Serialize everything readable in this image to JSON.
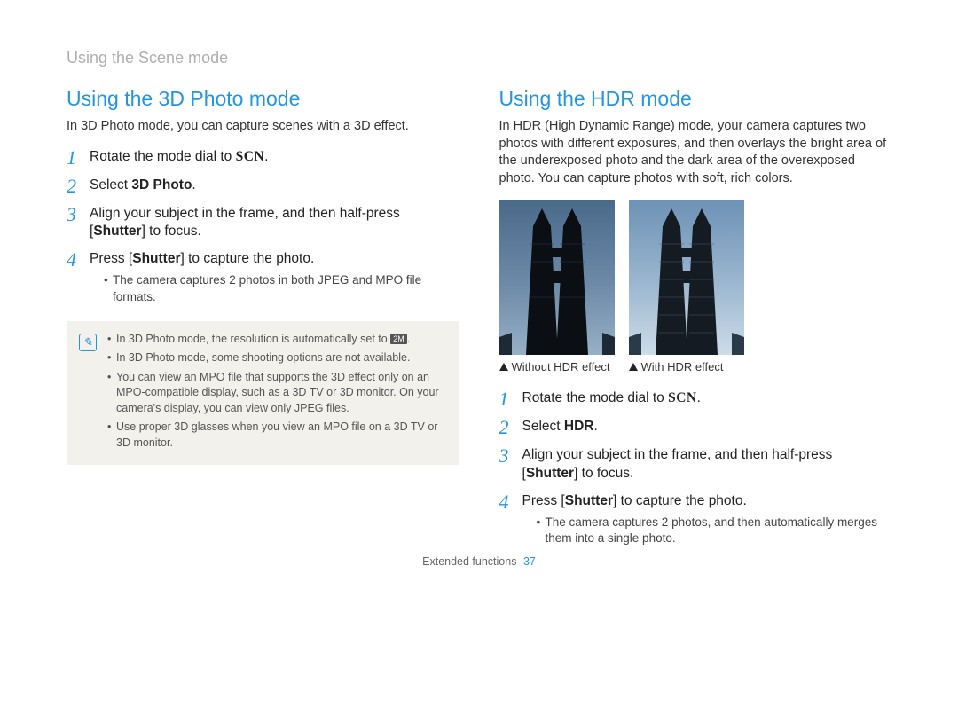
{
  "breadcrumb": "Using the Scene mode",
  "left": {
    "title": "Using the 3D Photo mode",
    "intro": "In 3D Photo mode, you can capture scenes with a 3D effect.",
    "scn_label": "SCN",
    "steps": {
      "s1_pre": "Rotate the mode dial to ",
      "s1_post": ".",
      "s2_pre": "Select ",
      "s2_bold": "3D Photo",
      "s2_post": ".",
      "s3_pre": "Align your subject in the frame, and then half-press [",
      "s3_bold": "Shutter",
      "s3_post": "] to focus.",
      "s4_pre": "Press [",
      "s4_bold": "Shutter",
      "s4_post": "] to capture the photo.",
      "s4_sub1": "The camera captures 2 photos in both JPEG and MPO file formats."
    },
    "notes": {
      "n1_pre": "In 3D Photo mode, the resolution is automatically set to ",
      "n1_chip": "2M",
      "n1_post": ".",
      "n2": "In 3D Photo mode, some shooting options are not available.",
      "n3": "You can view an MPO file that supports the 3D effect only on an MPO-compatible display, such as a 3D TV or 3D monitor. On your camera's display, you can view only JPEG files.",
      "n4": "Use proper 3D glasses when you view an MPO file on a 3D TV or 3D monitor."
    }
  },
  "right": {
    "title": "Using the HDR mode",
    "intro": "In HDR (High Dynamic Range) mode, your camera captures two photos with different exposures, and then overlays the bright area of the underexposed photo and the dark area of the overexposed photo. You can capture photos with soft, rich colors.",
    "caption_without": "Without HDR effect",
    "caption_with": "With HDR effect",
    "scn_label": "SCN",
    "steps": {
      "s1_pre": "Rotate the mode dial to ",
      "s1_post": ".",
      "s2_pre": "Select ",
      "s2_bold": "HDR",
      "s2_post": ".",
      "s3_pre": "Align your subject in the frame, and then half-press [",
      "s3_bold": "Shutter",
      "s3_post": "] to focus.",
      "s4_pre": "Press [",
      "s4_bold": "Shutter",
      "s4_post": "] to capture the photo.",
      "s4_sub1": "The camera captures 2 photos, and then automatically merges them into a single photo."
    }
  },
  "footer": {
    "section": "Extended functions",
    "page": "37"
  }
}
